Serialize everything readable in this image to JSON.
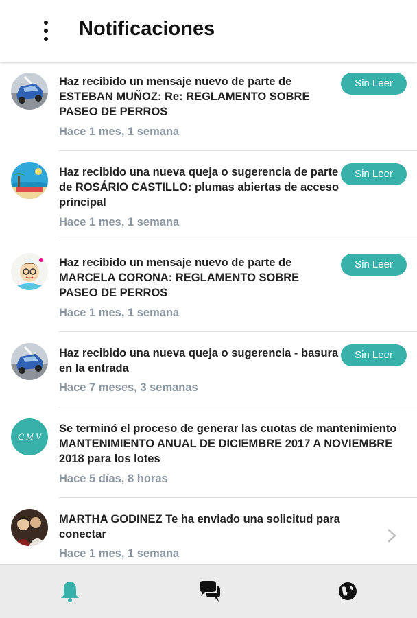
{
  "header": {
    "title": "Notificaciones",
    "menu_icon": "more-vert-icon"
  },
  "colors": {
    "accent": "#37b1aa",
    "time_text": "#8b96a0",
    "bottom_bar": "#ebebeb"
  },
  "notifications": [
    {
      "text": "Haz recibido un mensaje nuevo de parte de ESTEBAN MUÑOZ: Re: REGLAMENTO SOBRE PASEO DE PERROS",
      "time": "Hace 1 mes, 1 semana",
      "badge": "Sin Leer",
      "avatar": "car-avatar"
    },
    {
      "text": "Haz recibido una nueva queja o sugerencia de parte de  ROSÁRIO CASTILLO: plumas abiertas de acceso principal",
      "time": "Hace 1 mes, 1 semana",
      "badge": "Sin Leer",
      "avatar": "beach-avatar"
    },
    {
      "text": "Haz recibido un mensaje nuevo de parte de MARCELA CORONA: REGLAMENTO SOBRE PASEO DE PERROS",
      "time": "Hace 1 mes, 1 semana",
      "badge": "Sin Leer",
      "avatar": "cartoon-avatar"
    },
    {
      "text": "Haz recibido una nueva queja o sugerencia - basura en la entrada",
      "time": "Hace 7 meses, 3 semanas",
      "badge": "Sin Leer",
      "avatar": "car-avatar"
    },
    {
      "text": "Se terminó el proceso de generar las cuotas de mantenimiento MANTENIMIENTO ANUAL DE  DICIEMBRE 2017 A NOVIEMBRE 2018 para los lotes",
      "time": "Hace 5 días, 8 horas",
      "avatar": "initials-avatar",
      "avatar_text": "C M V"
    },
    {
      "text": "MARTHA GODINEZ Te ha enviado una solicitud para conectar",
      "time": "Hace 1 mes, 1 semana",
      "avatar": "photo-avatar",
      "chevron_icon": "chevron-right-icon"
    }
  ],
  "bottom_nav": {
    "items": [
      {
        "icon": "bell-icon",
        "active": true
      },
      {
        "icon": "chat-icon",
        "active": false
      },
      {
        "icon": "globe-icon",
        "active": false
      }
    ]
  }
}
